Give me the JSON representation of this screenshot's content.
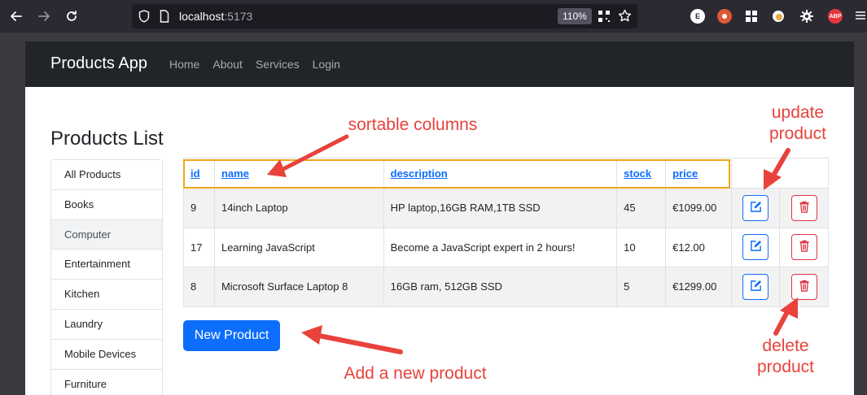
{
  "browser": {
    "url_host": "localhost",
    "url_port": ":5173",
    "zoom": "110%",
    "extensions": [
      {
        "icon": "e-extension-icon",
        "label": "E",
        "color": "#ffffff",
        "text_color": "#2b2a33"
      },
      {
        "icon": "duckduckgo-icon",
        "label": "",
        "color": "#de5833",
        "text_color": "#ffffff"
      },
      {
        "icon": "apps-grid-icon",
        "label": "",
        "color": "#2b2a33",
        "text_color": "#ffffff"
      },
      {
        "icon": "profile-icon",
        "label": "",
        "color": "#2b2a33",
        "text_color": "#ffffff"
      },
      {
        "icon": "settings-gear-icon",
        "label": "",
        "color": "#2b2a33",
        "text_color": "#ffffff"
      },
      {
        "icon": "adblock-plus-icon",
        "label": "ABP",
        "color": "#e4373c",
        "text_color": "#ffffff"
      }
    ]
  },
  "navbar": {
    "brand": "Products App",
    "links": [
      "Home",
      "About",
      "Services",
      "Login"
    ]
  },
  "page": {
    "title": "Products List"
  },
  "sidebar": {
    "items": [
      {
        "label": "All Products",
        "active": false
      },
      {
        "label": "Books",
        "active": false
      },
      {
        "label": "Computer",
        "active": true
      },
      {
        "label": "Entertainment",
        "active": false
      },
      {
        "label": "Kitchen",
        "active": false
      },
      {
        "label": "Laundry",
        "active": false
      },
      {
        "label": "Mobile Devices",
        "active": false
      },
      {
        "label": "Furniture",
        "active": false
      }
    ]
  },
  "table": {
    "columns": [
      "id",
      "name",
      "description",
      "stock",
      "price"
    ],
    "rows": [
      {
        "id": "9",
        "name": "14inch Laptop",
        "description": "HP laptop,16GB RAM,1TB SSD",
        "stock": "45",
        "price": "€1099.00"
      },
      {
        "id": "17",
        "name": "Learning JavaScript",
        "description": "Become a JavaScript expert in 2 hours!",
        "stock": "10",
        "price": "€12.00"
      },
      {
        "id": "8",
        "name": "Microsoft Surface Laptop 8",
        "description": "16GB ram, 512GB SSD",
        "stock": "5",
        "price": "€1299.00"
      }
    ]
  },
  "actions": {
    "new_product_label": "New Product"
  },
  "annotations": {
    "sortable": "sortable columns",
    "update": "update\nproduct",
    "delete": "delete\nproduct",
    "add": "Add a new product"
  },
  "colors": {
    "navbar_bg": "#212529",
    "primary": "#0d6efd",
    "danger": "#dc3545",
    "annotation": "#e8423b",
    "highlight": "#f0a81a"
  }
}
